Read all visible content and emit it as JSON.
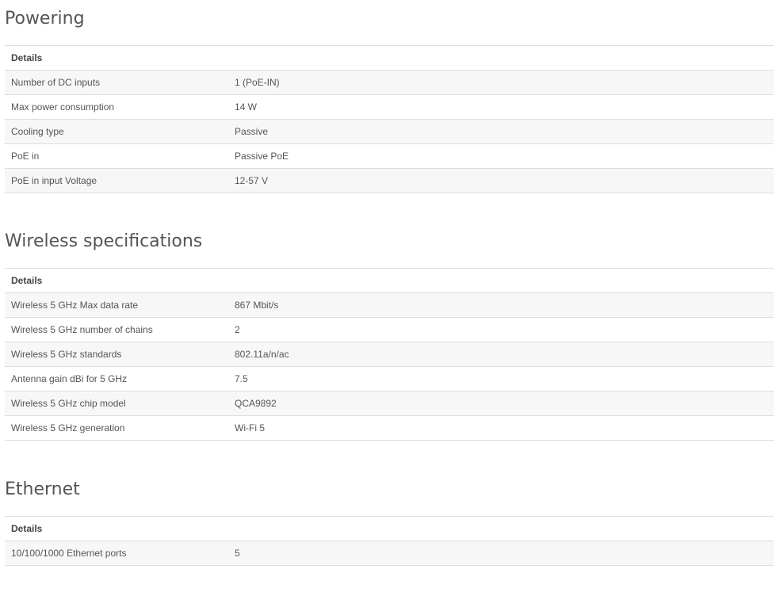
{
  "sections": [
    {
      "title": "Powering",
      "header": "Details",
      "rows": [
        {
          "label": "Number of DC inputs",
          "value": "1 (PoE-IN)"
        },
        {
          "label": "Max power consumption",
          "value": "14 W"
        },
        {
          "label": "Cooling type",
          "value": "Passive"
        },
        {
          "label": "PoE in",
          "value": "Passive PoE"
        },
        {
          "label": "PoE in input Voltage",
          "value": "12-57 V"
        }
      ]
    },
    {
      "title": "Wireless specifications",
      "header": "Details",
      "rows": [
        {
          "label": "Wireless 5 GHz Max data rate",
          "value": "867 Mbit/s"
        },
        {
          "label": "Wireless 5 GHz number of chains",
          "value": "2"
        },
        {
          "label": "Wireless 5 GHz standards",
          "value": "802.11a/n/ac"
        },
        {
          "label": "Antenna gain dBi for 5 GHz",
          "value": "7.5"
        },
        {
          "label": "Wireless 5 GHz chip model",
          "value": "QCA9892"
        },
        {
          "label": "Wireless 5 GHz generation",
          "value": "Wi-Fi 5"
        }
      ]
    },
    {
      "title": "Ethernet",
      "header": "Details",
      "rows": [
        {
          "label": "10/100/1000 Ethernet ports",
          "value": "5"
        }
      ]
    }
  ]
}
